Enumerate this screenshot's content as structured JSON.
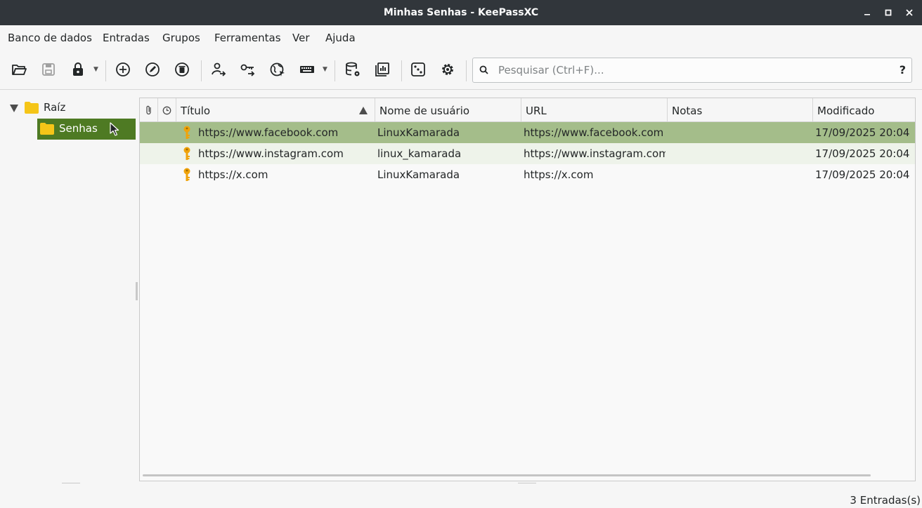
{
  "window": {
    "title": "Minhas Senhas - KeePassXC"
  },
  "menu": [
    "Banco de dados",
    "Entradas",
    "Grupos",
    "Ferramentas",
    "Ver",
    "Ajuda"
  ],
  "search": {
    "placeholder": "Pesquisar (Ctrl+F)...",
    "value": "",
    "help": "?"
  },
  "tree": {
    "root": "Raíz",
    "child": "Senhas"
  },
  "table": {
    "headers": [
      "Título",
      "Nome de usuário",
      "URL",
      "Notas",
      "Modificado"
    ],
    "sort_column": "Título",
    "rows": [
      {
        "title": "https://www.facebook.com",
        "username": "LinuxKamarada",
        "url": "https://www.facebook.com",
        "notes": "",
        "modified": "17/09/2025 20:04"
      },
      {
        "title": "https://www.instagram.com",
        "username": "linux_kamarada",
        "url": "https://www.instagram.com",
        "notes": "",
        "modified": "17/09/2025 20:04"
      },
      {
        "title": "https://x.com",
        "username": "LinuxKamarada",
        "url": "https://x.com",
        "notes": "",
        "modified": "17/09/2025 20:04"
      }
    ]
  },
  "status": {
    "entries": "3 Entradas(s)"
  },
  "colors": {
    "selection": "#4e7a23",
    "row_selected": "#a4bd8a",
    "key_icon": "#f0a30a",
    "folder": "#f5c518",
    "titlebar": "#31363b"
  }
}
